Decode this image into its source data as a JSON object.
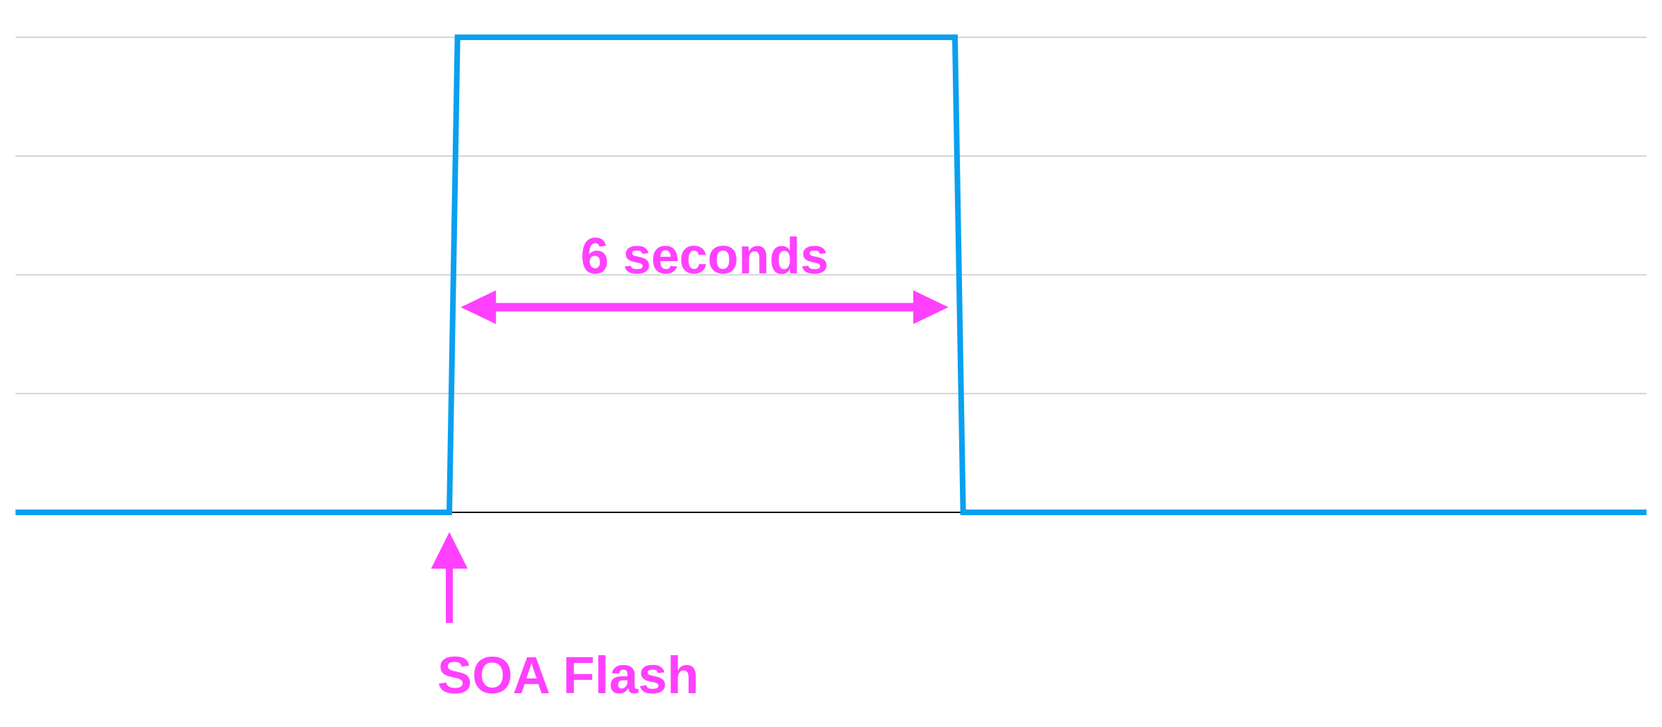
{
  "chart_data": {
    "type": "line",
    "title": "",
    "xlabel": "",
    "ylabel": "",
    "grid": true,
    "gridlines": 4,
    "series": [
      {
        "color": "#0AA0F0",
        "points": [
          [
            0,
            0
          ],
          [
            26.6,
            0
          ],
          [
            27.1,
            1
          ],
          [
            57.6,
            1
          ],
          [
            58.1,
            0
          ],
          [
            100,
            0
          ]
        ]
      }
    ],
    "xlim": [
      0,
      100
    ],
    "ylim": [
      0,
      1
    ],
    "annotations": [
      {
        "id": "duration",
        "text": "6 seconds",
        "x_start": 27.3,
        "x_end": 57.2,
        "y": 0.5
      },
      {
        "id": "flash",
        "text": "SOA Flash",
        "x": 26.6
      }
    ]
  },
  "colors": {
    "signal": "#0AA0F0",
    "annotation": "#FF40FF",
    "grid": "#D4D4D4",
    "baseline": "#000000"
  }
}
